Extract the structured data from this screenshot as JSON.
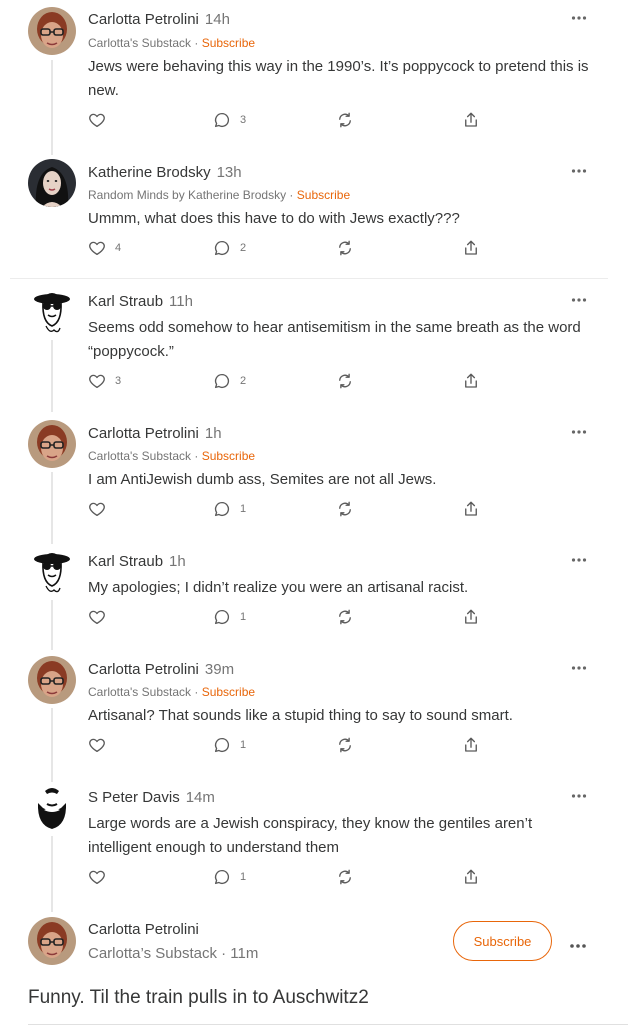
{
  "comments": [
    {
      "author": "Carlotta Petrolini",
      "time": "14h",
      "publication": "Carlotta's Substack",
      "separator": " · ",
      "subscribe": "Subscribe",
      "body": "Jews were behaving this way in the 1990’s. It’s poppycock to pretend this is new.",
      "likes": "",
      "replies": "3",
      "avatar": "carlotta-avatar"
    },
    {
      "author": "Katherine Brodsky",
      "time": "13h",
      "publication": "Random Minds by Katherine Brodsky",
      "separator": " · ",
      "subscribe": "Subscribe",
      "body": "Ummm, what does this have to do with Jews exactly???",
      "likes": "4",
      "replies": "2",
      "avatar": "katherine-avatar"
    },
    {
      "author": "Karl Straub",
      "time": "11h",
      "body": "Seems odd somehow to hear antisemitism in the same breath as the word “poppycock.”",
      "likes": "3",
      "replies": "2",
      "avatar": "karl-avatar"
    },
    {
      "author": "Carlotta Petrolini",
      "time": "1h",
      "publication": "Carlotta's Substack",
      "separator": " · ",
      "subscribe": "Subscribe",
      "body": "I am AntiJewish dumb ass, Semites are not all Jews.",
      "likes": "",
      "replies": "1",
      "avatar": "carlotta-avatar"
    },
    {
      "author": "Karl Straub",
      "time": "1h",
      "body": "My apologies; I didn’t realize you were an artisanal racist.",
      "likes": "",
      "replies": "1",
      "avatar": "karl-avatar"
    },
    {
      "author": "Carlotta Petrolini",
      "time": "39m",
      "publication": "Carlotta's Substack",
      "separator": " · ",
      "subscribe": "Subscribe",
      "body": "Artisanal? That sounds like a stupid thing to say to sound smart.",
      "likes": "",
      "replies": "1",
      "avatar": "carlotta-avatar"
    },
    {
      "author": "S Peter Davis",
      "time": "14m",
      "body": "Large words are a Jewish conspiracy, they know the gentiles aren’t intelligent enough to understand them",
      "likes": "",
      "replies": "1",
      "avatar": "peter-avatar"
    }
  ],
  "final": {
    "author": "Carlotta Petrolini",
    "meta": "Carlotta’s Substack · 11m",
    "subscribe_button": "Subscribe",
    "body": "Funny. Til the train pulls in to Auschwitz2"
  },
  "colors": {
    "accent": "#e8660a",
    "text": "#363737",
    "muted": "#757575"
  }
}
